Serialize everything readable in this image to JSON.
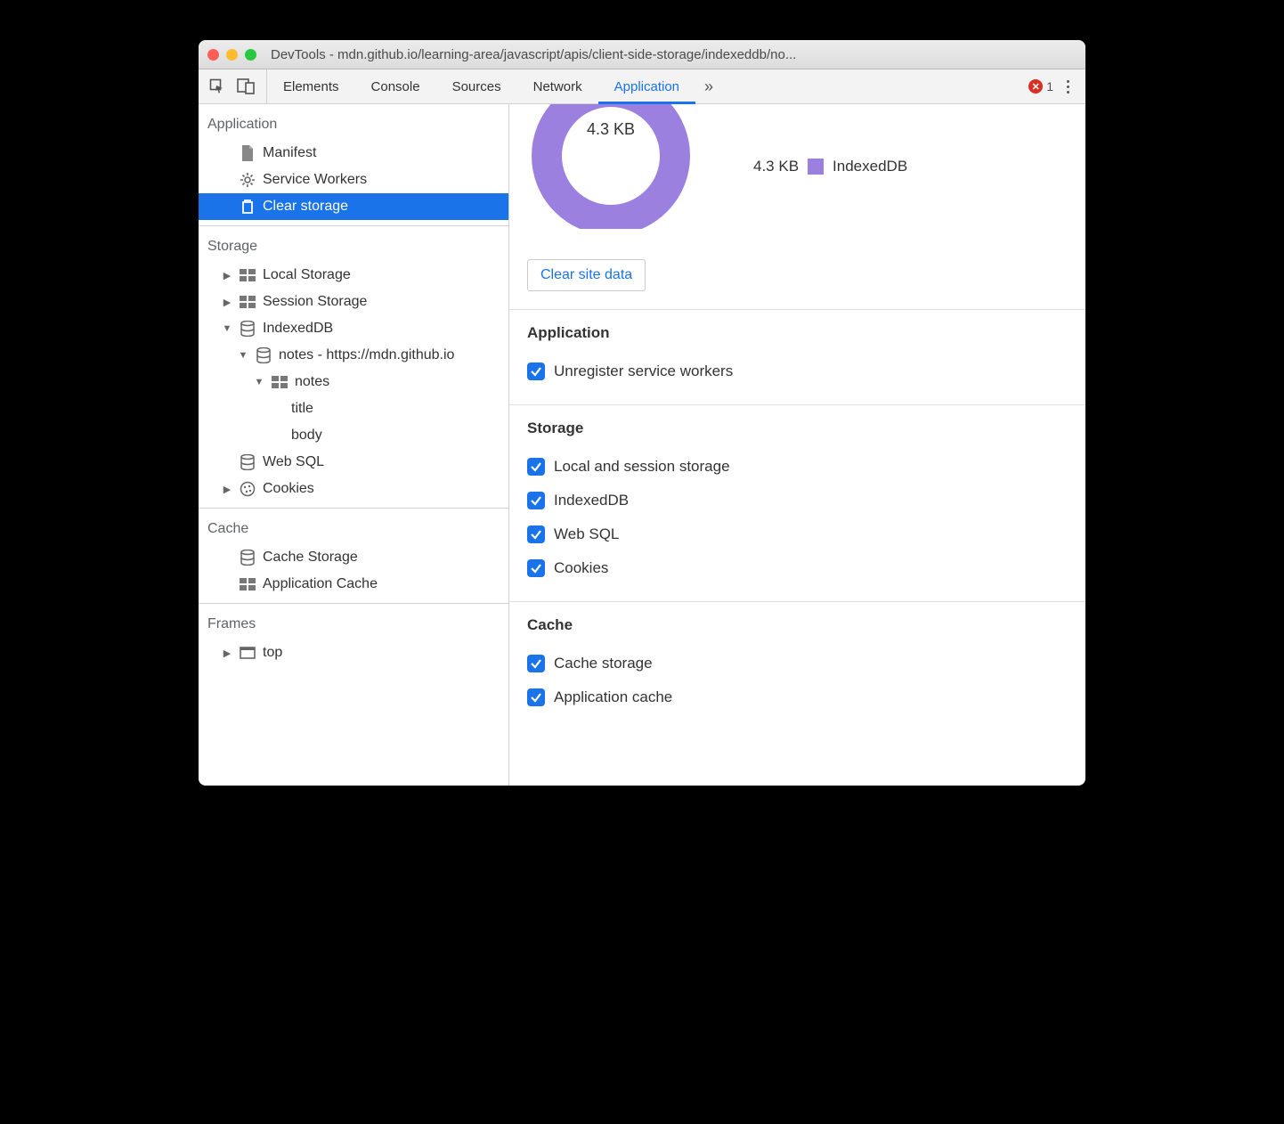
{
  "window_title": "DevTools - mdn.github.io/learning-area/javascript/apis/client-side-storage/indexeddb/no...",
  "tabs": {
    "elements": "Elements",
    "console": "Console",
    "sources": "Sources",
    "network": "Network",
    "application": "Application"
  },
  "errors": {
    "count": "1"
  },
  "sidebar": {
    "application": {
      "heading": "Application",
      "manifest": "Manifest",
      "service_workers": "Service Workers",
      "clear_storage": "Clear storage"
    },
    "storage": {
      "heading": "Storage",
      "local_storage": "Local Storage",
      "session_storage": "Session Storage",
      "indexeddb": "IndexedDB",
      "db_notes": "notes - https://mdn.github.io",
      "store_notes": "notes",
      "field_title": "title",
      "field_body": "body",
      "web_sql": "Web SQL",
      "cookies": "Cookies"
    },
    "cache": {
      "heading": "Cache",
      "cache_storage": "Cache Storage",
      "application_cache": "Application Cache"
    },
    "frames": {
      "heading": "Frames",
      "top": "top"
    }
  },
  "chart": {
    "total": "4.3 KB",
    "legend_value": "4.3 KB",
    "legend_label": "IndexedDB"
  },
  "clear_button": "Clear site data",
  "sections": {
    "application": {
      "heading": "Application",
      "unregister": "Unregister service workers"
    },
    "storage": {
      "heading": "Storage",
      "local_session": "Local and session storage",
      "indexeddb": "IndexedDB",
      "web_sql": "Web SQL",
      "cookies": "Cookies"
    },
    "cache": {
      "heading": "Cache",
      "cache_storage": "Cache storage",
      "application_cache": "Application cache"
    }
  }
}
